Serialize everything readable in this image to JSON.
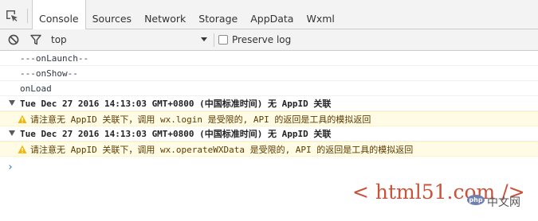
{
  "devtools": {
    "tabs": [
      {
        "label": "Console",
        "active": true
      },
      {
        "label": "Sources",
        "active": false
      },
      {
        "label": "Network",
        "active": false
      },
      {
        "label": "Storage",
        "active": false
      },
      {
        "label": "AppData",
        "active": false
      },
      {
        "label": "Wxml",
        "active": false
      }
    ]
  },
  "toolbar": {
    "context": "top",
    "preserve_log_label": "Preserve log",
    "preserve_log_checked": false
  },
  "console": {
    "messages": [
      {
        "type": "log",
        "text": "---onLaunch--"
      },
      {
        "type": "log",
        "text": "---onShow--"
      },
      {
        "type": "log",
        "text": "onLoad"
      },
      {
        "type": "group",
        "text": "Tue Dec 27 2016 14:13:03 GMT+0800 (中国标准时间) 无 AppID 关联"
      },
      {
        "type": "warn",
        "text": "请注意无 AppID 关联下，调用 wx.login 是受限的, API 的返回是工具的模拟返回"
      },
      {
        "type": "group",
        "text": "Tue Dec 27 2016 14:13:03 GMT+0800 (中国标准时间) 无 AppID 关联"
      },
      {
        "type": "warn",
        "text": "请注意无 AppID 关联下，调用 wx.operateWXData 是受限的, API 的返回是工具的模拟返回"
      }
    ],
    "prompt_symbol": "›"
  },
  "watermark": {
    "site": "< html51.com />",
    "badge": "php",
    "cn": "中文网"
  },
  "colors": {
    "warn_background": "#fffbe5",
    "warn_icon": "#f5b400",
    "prompt": "#2c72c7",
    "watermark": "#c8523a"
  }
}
